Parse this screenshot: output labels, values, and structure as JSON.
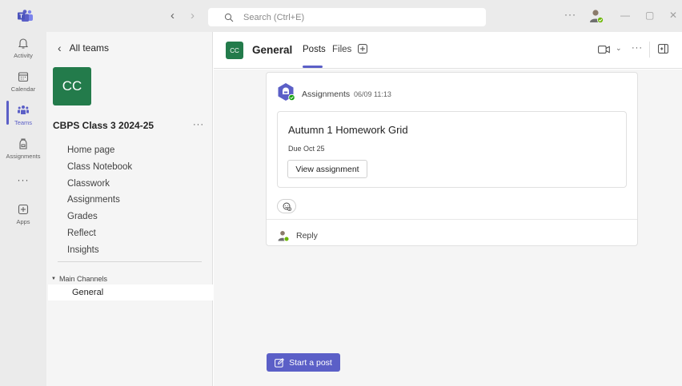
{
  "titlebar": {
    "search_placeholder": "Search (Ctrl+E)",
    "back_arrow": "‹",
    "forward_arrow": "›",
    "more": "···",
    "minimize": "—",
    "maximize": "▢",
    "close": "✕"
  },
  "rail": {
    "items": [
      {
        "label": "Activity",
        "icon": "bell-icon"
      },
      {
        "label": "Calendar",
        "icon": "calendar-icon"
      },
      {
        "label": "Teams",
        "icon": "teams-icon"
      },
      {
        "label": "Assignments",
        "icon": "backpack-icon"
      },
      {
        "label": "",
        "icon": "more-icon",
        "glyph": "···"
      },
      {
        "label": "Apps",
        "icon": "plus-box-icon"
      }
    ],
    "active": "Teams"
  },
  "sidebar": {
    "back_label": "All teams",
    "team_initials": "CC",
    "team_name": "CBPS Class 3 2024-25",
    "more": "···",
    "tabs": [
      "Home page",
      "Class Notebook",
      "Classwork",
      "Assignments",
      "Grades",
      "Reflect",
      "Insights"
    ],
    "channels_header": "Main Channels",
    "channels": [
      "General"
    ]
  },
  "channel_header": {
    "badge": "CC",
    "name": "General",
    "tabs": [
      "Posts",
      "Files"
    ],
    "active_tab": "Posts",
    "more": "···"
  },
  "post": {
    "author": "Assignments",
    "time": "06/09 11:13",
    "assignment_title": "Autumn 1 Homework Grid",
    "due": "Due Oct 25",
    "view_button": "View assignment",
    "reply_label": "Reply"
  },
  "compose": {
    "start_post_label": "Start a post"
  },
  "colors": {
    "brand": "#5b5fc7",
    "team_green": "#237b4b",
    "rail_bg": "#ebebeb",
    "sidebar_bg": "#f5f5f5"
  }
}
